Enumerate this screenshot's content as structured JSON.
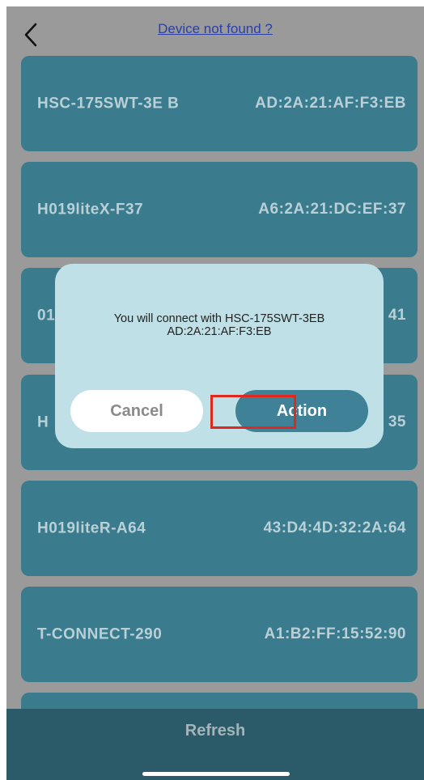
{
  "header": {
    "back_icon": "chevron-left-icon",
    "link_label": "Device not found ?"
  },
  "devices": [
    {
      "name": "HSC-175SWT-3E B",
      "mac": "AD:2A:21:AF:F3:EB"
    },
    {
      "name": "H019liteX-F37",
      "mac": "A6:2A:21:DC:EF:37"
    },
    {
      "name": "01",
      "mac": "41"
    },
    {
      "name": "H",
      "mac": "35"
    },
    {
      "name": "H019liteR-A64",
      "mac": "43:D4:4D:32:2A:64"
    },
    {
      "name": "T-CONNECT-290",
      "mac": "A1:B2:FF:15:52:90"
    }
  ],
  "dialog": {
    "message_line1": "You will connect with HSC-175SWT-3EB",
    "message_line2": "AD:2A:21:AF:F3:EB",
    "cancel_label": "Cancel",
    "action_label": "Action"
  },
  "footer": {
    "refresh_label": "Refresh"
  },
  "colors": {
    "overlay_gray": "#9a9a9a",
    "card": "#3a7b8d",
    "dialog_bg": "#bfe0e6",
    "action_button": "#3f8196",
    "footer": "#2b5b68",
    "highlight": "#e0281e"
  }
}
